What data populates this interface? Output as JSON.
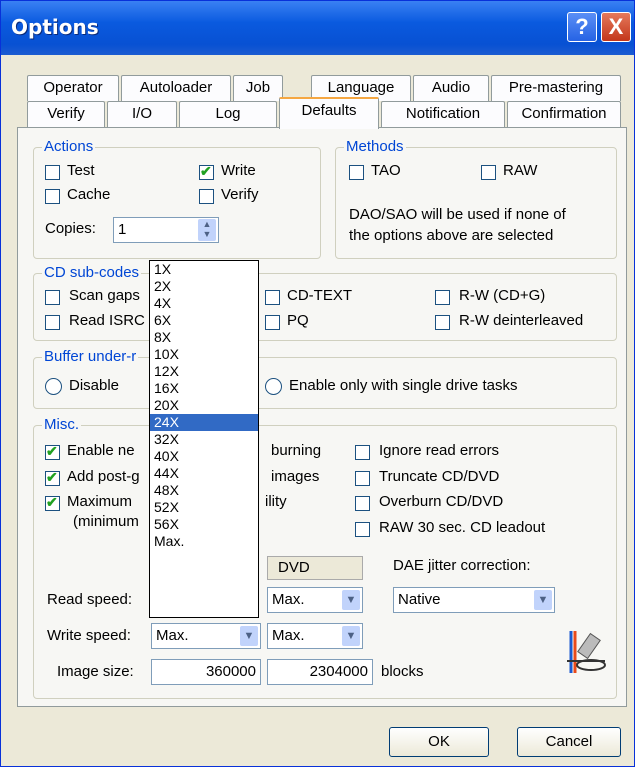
{
  "window": {
    "title": "Options",
    "help": "?",
    "close": "X"
  },
  "tabs_row1": [
    "Operator",
    "Autoloader",
    "Job",
    "Language",
    "Audio",
    "Pre-mastering"
  ],
  "tabs_row2": [
    "Verify",
    "I/O",
    "Log",
    "Defaults",
    "Notification",
    "Confirmation"
  ],
  "actions": {
    "title": "Actions",
    "test": "Test",
    "write": "Write",
    "cache": "Cache",
    "verify": "Verify",
    "copies_label": "Copies:",
    "copies_value": "1"
  },
  "methods": {
    "title": "Methods",
    "tao": "TAO",
    "raw": "RAW",
    "note1": "DAO/SAO will be used if none of",
    "note2": "the options above are selected"
  },
  "subcodes": {
    "title": "CD sub-codes",
    "scan_gaps": "Scan gaps",
    "read_isrc": "Read ISRC",
    "cdtext": "CD-TEXT",
    "pq": "PQ",
    "rw_cdg": "R-W (CD+G)",
    "rw_deint": "R-W deinterleaved"
  },
  "buffer": {
    "title": "Buffer under-r",
    "disable": "Disable",
    "single": "Enable only with single drive tasks"
  },
  "misc": {
    "title": "Misc.",
    "enable": "Enable ne",
    "burning": "burning",
    "addpost": "Add post-g",
    "images": "images",
    "maximum": "Maximum",
    "ility": "ility",
    "minimum": "(minimum",
    "ignore": "Ignore read errors",
    "truncate": "Truncate CD/DVD",
    "overburn": "Overburn CD/DVD",
    "raw30": "RAW 30 sec. CD leadout"
  },
  "speeds": {
    "dvd_label": "DVD",
    "dae_label": "DAE jitter correction:",
    "read_label": "Read speed:",
    "write_label": "Write speed:",
    "image_label": "Image size:",
    "read_dvd": "Max.",
    "dae_value": "Native",
    "write_cd": "Max.",
    "write_dvd": "Max.",
    "image_cd": "360000",
    "image_dvd": "2304000",
    "blocks": "blocks"
  },
  "speed_list": [
    "1X",
    "2X",
    "4X",
    "6X",
    "8X",
    "10X",
    "12X",
    "16X",
    "20X",
    "24X",
    "32X",
    "40X",
    "44X",
    "48X",
    "52X",
    "56X",
    "Max."
  ],
  "speed_list_selected": "24X",
  "buttons": {
    "ok": "OK",
    "cancel": "Cancel"
  }
}
